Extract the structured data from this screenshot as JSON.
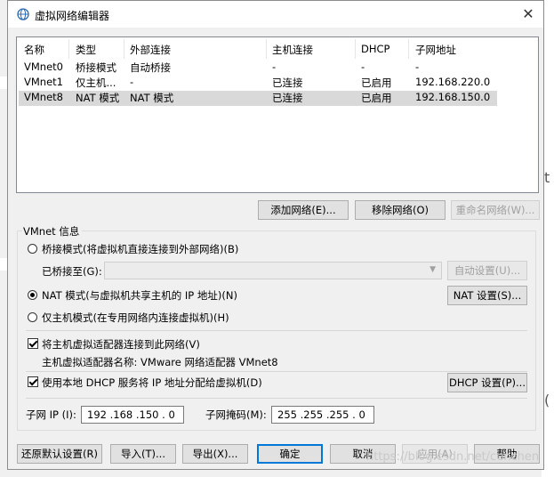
{
  "window": {
    "title": "虚拟网络编辑器",
    "close_glyph": "✕"
  },
  "table": {
    "headers": [
      "名称",
      "类型",
      "外部连接",
      "主机连接",
      "DHCP",
      "子网地址"
    ],
    "rows": [
      [
        "VMnet0",
        "桥接模式",
        "自动桥接",
        "-",
        "-",
        "-"
      ],
      [
        "VMnet1",
        "仅主机...",
        "-",
        "已连接",
        "已启用",
        "192.168.220.0"
      ],
      [
        "VMnet8",
        "NAT 模式",
        "NAT 模式",
        "已连接",
        "已启用",
        "192.168.150.0"
      ]
    ],
    "selected_row": 2
  },
  "table_buttons": {
    "add": "添加网络(E)...",
    "remove": "移除网络(O)",
    "rename": "重命名网络(W)..."
  },
  "vmnet_info": {
    "group_title": "VMnet 信息",
    "bridge_label": "桥接模式(将虚拟机直接连接到外部网络)(B)",
    "bridged_to_label": "已桥接至(G):",
    "bridged_to_value": "",
    "auto_settings": "自动设置(U)...",
    "nat_label": "NAT 模式(与虚拟机共享主机的 IP 地址)(N)",
    "nat_settings": "NAT 设置(S)...",
    "hostonly_label": "仅主机模式(在专用网络内连接虚拟机)(H)",
    "selected_mode": "nat",
    "connect_adapter_label": "将主机虚拟适配器连接到此网络(V)",
    "connect_adapter_checked": true,
    "adapter_name_label": "主机虚拟适配器名称: VMware 网络适配器 VMnet8",
    "dhcp_label": "使用本地 DHCP 服务将 IP 地址分配给虚拟机(D)",
    "dhcp_checked": true,
    "dhcp_settings": "DHCP 设置(P)...",
    "subnet_ip_label": "子网 IP (I):",
    "subnet_ip_value": "192 .168 .150 . 0",
    "subnet_mask_label": "子网掩码(M):",
    "subnet_mask_value": "255 .255 .255 . 0"
  },
  "footer": {
    "restore": "还原默认设置(R)",
    "import": "导入(T)...",
    "export": "导出(X)...",
    "ok": "确定",
    "cancel": "取消",
    "apply": "应用(A)",
    "help": "帮助"
  },
  "watermark": "https://blog.csdn.net/cenchen",
  "colors": {
    "title_bg": "#ffffff",
    "dialog_bg": "#f0f0f0",
    "selected_row": "#d9d9d9",
    "focus_border": "#0078d7"
  }
}
